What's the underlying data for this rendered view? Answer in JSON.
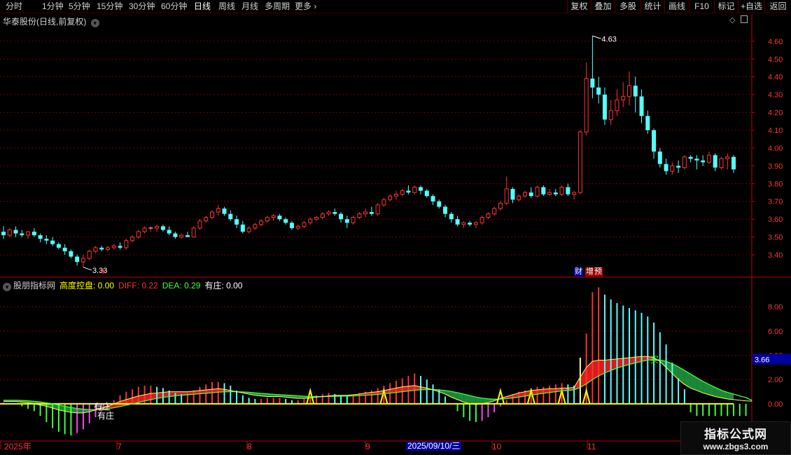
{
  "toolbar": {
    "periods": [
      "分时",
      "1分钟",
      "5分钟",
      "15分钟",
      "30分钟",
      "60分钟",
      "日线",
      "周线",
      "月线",
      "多周期",
      "更多"
    ],
    "active_period": "日线",
    "right_buttons": [
      "复权",
      "叠加",
      "多股",
      "统计",
      "画线",
      "F10",
      "标记",
      "+自选",
      "返回"
    ]
  },
  "stock": {
    "title": "华泰股份(日线,前复权)",
    "high_label": "4.63",
    "low_label": "3.33"
  },
  "price_axis": {
    "ticks": [
      "4.60",
      "4.50",
      "4.40",
      "4.30",
      "4.20",
      "4.10",
      "4.00",
      "3.90",
      "3.80",
      "3.70",
      "3.60",
      "3.50",
      "3.40"
    ]
  },
  "badges": {
    "cai": "财",
    "zeng": "增",
    "ji": "预",
    "mini": "♣"
  },
  "indicator": {
    "name": "股朋指标网",
    "items": [
      {
        "label": "高度控盘: 0.00",
        "color": "#ffff00"
      },
      {
        "label": "DIFF: 0.22",
        "color": "#ff3030"
      },
      {
        "label": "DEA: 0.29",
        "color": "#40ff40"
      },
      {
        "label": "有庄: 0.00",
        "color": "#ffffff"
      }
    ],
    "ticks": [
      "8.00",
      "6.00",
      "4.00",
      "2.00",
      "0.00"
    ],
    "current_value": "3.66",
    "annotations": {
      "you_zhuang": "有庄",
      "mai": "买"
    }
  },
  "dates": {
    "labels": [
      "2025年",
      "7",
      "8",
      "9",
      "10",
      "11"
    ],
    "cursor": "2025/09/10/三"
  },
  "watermark": {
    "main": "指标公式网",
    "sub": "www.zbgs3.com"
  },
  "colors": {
    "up": "#ff3232",
    "down": "#54ffff",
    "grid": "#7a0000",
    "axis": "#c00000"
  },
  "chart_data": {
    "type": "candlestick",
    "price_range": [
      3.29,
      4.69
    ],
    "candles": [
      [
        3.53,
        3.56,
        3.49,
        3.51
      ],
      [
        3.51,
        3.55,
        3.5,
        3.54
      ],
      [
        3.54,
        3.56,
        3.5,
        3.52
      ],
      [
        3.52,
        3.54,
        3.5,
        3.51
      ],
      [
        3.51,
        3.53,
        3.49,
        3.53
      ],
      [
        3.53,
        3.55,
        3.5,
        3.51
      ],
      [
        3.51,
        3.52,
        3.47,
        3.49
      ],
      [
        3.49,
        3.51,
        3.46,
        3.48
      ],
      [
        3.48,
        3.5,
        3.45,
        3.46
      ],
      [
        3.46,
        3.47,
        3.43,
        3.44
      ],
      [
        3.44,
        3.46,
        3.4,
        3.42
      ],
      [
        3.42,
        3.43,
        3.38,
        3.39
      ],
      [
        3.39,
        3.4,
        3.34,
        3.36
      ],
      [
        3.36,
        3.4,
        3.33,
        3.38
      ],
      [
        3.38,
        3.43,
        3.37,
        3.42
      ],
      [
        3.42,
        3.45,
        3.41,
        3.44
      ],
      [
        3.44,
        3.45,
        3.42,
        3.43
      ],
      [
        3.43,
        3.45,
        3.42,
        3.44
      ],
      [
        3.44,
        3.46,
        3.43,
        3.45
      ],
      [
        3.45,
        3.47,
        3.43,
        3.44
      ],
      [
        3.44,
        3.49,
        3.43,
        3.48
      ],
      [
        3.48,
        3.51,
        3.47,
        3.5
      ],
      [
        3.5,
        3.54,
        3.49,
        3.53
      ],
      [
        3.53,
        3.56,
        3.52,
        3.55
      ],
      [
        3.55,
        3.56,
        3.53,
        3.55
      ],
      [
        3.55,
        3.57,
        3.53,
        3.56
      ],
      [
        3.56,
        3.57,
        3.53,
        3.54
      ],
      [
        3.54,
        3.56,
        3.51,
        3.52
      ],
      [
        3.52,
        3.53,
        3.49,
        3.5
      ],
      [
        3.5,
        3.52,
        3.49,
        3.51
      ],
      [
        3.51,
        3.53,
        3.5,
        3.5
      ],
      [
        3.5,
        3.56,
        3.5,
        3.55
      ],
      [
        3.55,
        3.6,
        3.54,
        3.59
      ],
      [
        3.59,
        3.62,
        3.58,
        3.61
      ],
      [
        3.61,
        3.65,
        3.6,
        3.64
      ],
      [
        3.64,
        3.68,
        3.62,
        3.66
      ],
      [
        3.66,
        3.67,
        3.62,
        3.63
      ],
      [
        3.63,
        3.65,
        3.59,
        3.6
      ],
      [
        3.6,
        3.62,
        3.55,
        3.57
      ],
      [
        3.57,
        3.59,
        3.52,
        3.53
      ],
      [
        3.53,
        3.56,
        3.52,
        3.55
      ],
      [
        3.55,
        3.58,
        3.54,
        3.57
      ],
      [
        3.57,
        3.6,
        3.56,
        3.59
      ],
      [
        3.59,
        3.62,
        3.58,
        3.61
      ],
      [
        3.61,
        3.63,
        3.59,
        3.62
      ],
      [
        3.62,
        3.63,
        3.59,
        3.6
      ],
      [
        3.6,
        3.61,
        3.57,
        3.58
      ],
      [
        3.58,
        3.59,
        3.54,
        3.55
      ],
      [
        3.55,
        3.57,
        3.54,
        3.56
      ],
      [
        3.56,
        3.59,
        3.55,
        3.58
      ],
      [
        3.58,
        3.61,
        3.57,
        3.6
      ],
      [
        3.6,
        3.62,
        3.59,
        3.61
      ],
      [
        3.61,
        3.64,
        3.6,
        3.63
      ],
      [
        3.63,
        3.65,
        3.62,
        3.64
      ],
      [
        3.64,
        3.66,
        3.62,
        3.63
      ],
      [
        3.63,
        3.64,
        3.58,
        3.6
      ],
      [
        3.6,
        3.62,
        3.55,
        3.58
      ],
      [
        3.58,
        3.62,
        3.57,
        3.61
      ],
      [
        3.61,
        3.64,
        3.6,
        3.63
      ],
      [
        3.63,
        3.66,
        3.61,
        3.64
      ],
      [
        3.64,
        3.67,
        3.62,
        3.63
      ],
      [
        3.63,
        3.69,
        3.62,
        3.68
      ],
      [
        3.68,
        3.72,
        3.67,
        3.71
      ],
      [
        3.71,
        3.74,
        3.7,
        3.73
      ],
      [
        3.73,
        3.76,
        3.71,
        3.74
      ],
      [
        3.74,
        3.77,
        3.73,
        3.76
      ],
      [
        3.76,
        3.79,
        3.74,
        3.75
      ],
      [
        3.75,
        3.79,
        3.74,
        3.78
      ],
      [
        3.78,
        3.79,
        3.74,
        3.76
      ],
      [
        3.76,
        3.77,
        3.72,
        3.73
      ],
      [
        3.73,
        3.74,
        3.68,
        3.7
      ],
      [
        3.7,
        3.71,
        3.66,
        3.67
      ],
      [
        3.67,
        3.68,
        3.61,
        3.63
      ],
      [
        3.63,
        3.64,
        3.58,
        3.6
      ],
      [
        3.6,
        3.62,
        3.56,
        3.57
      ],
      [
        3.57,
        3.59,
        3.55,
        3.58
      ],
      [
        3.58,
        3.59,
        3.56,
        3.57
      ],
      [
        3.57,
        3.59,
        3.55,
        3.58
      ],
      [
        3.58,
        3.62,
        3.57,
        3.61
      ],
      [
        3.61,
        3.64,
        3.6,
        3.63
      ],
      [
        3.63,
        3.67,
        3.62,
        3.66
      ],
      [
        3.66,
        3.7,
        3.65,
        3.69
      ],
      [
        3.69,
        3.84,
        3.68,
        3.77
      ],
      [
        3.77,
        3.78,
        3.69,
        3.71
      ],
      [
        3.71,
        3.74,
        3.7,
        3.73
      ],
      [
        3.73,
        3.76,
        3.72,
        3.75
      ],
      [
        3.75,
        3.78,
        3.72,
        3.73
      ],
      [
        3.73,
        3.79,
        3.72,
        3.78
      ],
      [
        3.78,
        3.79,
        3.73,
        3.74
      ],
      [
        3.74,
        3.77,
        3.73,
        3.75
      ],
      [
        3.75,
        3.77,
        3.73,
        3.74
      ],
      [
        3.74,
        3.79,
        3.73,
        3.78
      ],
      [
        3.78,
        3.8,
        3.73,
        3.74
      ],
      [
        3.74,
        3.76,
        3.71,
        3.75
      ],
      [
        3.75,
        4.1,
        3.74,
        4.09
      ],
      [
        4.09,
        4.48,
        4.07,
        4.39
      ],
      [
        4.39,
        4.63,
        4.28,
        4.34
      ],
      [
        4.34,
        4.4,
        4.25,
        4.3
      ],
      [
        4.3,
        4.34,
        4.13,
        4.16
      ],
      [
        4.16,
        4.27,
        4.13,
        4.21
      ],
      [
        4.21,
        4.33,
        4.18,
        4.27
      ],
      [
        4.27,
        4.37,
        4.23,
        4.29
      ],
      [
        4.29,
        4.43,
        4.24,
        4.35
      ],
      [
        4.35,
        4.4,
        4.2,
        4.29
      ],
      [
        4.29,
        4.33,
        4.14,
        4.18
      ],
      [
        4.18,
        4.21,
        4.08,
        4.1
      ],
      [
        4.1,
        4.11,
        3.94,
        3.98
      ],
      [
        3.98,
        4.0,
        3.89,
        3.91
      ],
      [
        3.91,
        3.94,
        3.85,
        3.87
      ],
      [
        3.87,
        3.92,
        3.85,
        3.9
      ],
      [
        3.9,
        3.93,
        3.86,
        3.89
      ],
      [
        3.89,
        3.96,
        3.88,
        3.95
      ],
      [
        3.95,
        3.96,
        3.92,
        3.94
      ],
      [
        3.94,
        3.96,
        3.88,
        3.93
      ],
      [
        3.93,
        3.96,
        3.9,
        3.92
      ],
      [
        3.92,
        3.98,
        3.91,
        3.96
      ],
      [
        3.96,
        3.97,
        3.87,
        3.89
      ],
      [
        3.89,
        3.95,
        3.88,
        3.94
      ],
      [
        3.94,
        3.97,
        3.88,
        3.95
      ],
      [
        3.95,
        3.96,
        3.86,
        3.88
      ]
    ],
    "indicator_range": [
      -2.6,
      9.8
    ],
    "macd_bars": [
      0.1,
      0.05,
      0.0,
      -0.2,
      -0.4,
      -0.6,
      -1.0,
      -1.5,
      -2.0,
      -2.3,
      -2.5,
      -2.6,
      -2.4,
      -2.1,
      -1.6,
      -1.1,
      -0.6,
      -0.2,
      0.3,
      0.7,
      1.0,
      1.2,
      1.4,
      1.5,
      1.5,
      1.4,
      1.3,
      1.1,
      0.9,
      0.8,
      0.9,
      1.1,
      1.4,
      1.6,
      1.8,
      1.8,
      1.7,
      1.5,
      1.1,
      0.7,
      0.5,
      0.4,
      0.4,
      0.5,
      0.5,
      0.5,
      0.4,
      0.3,
      0.3,
      0.4,
      0.5,
      0.7,
      0.8,
      0.9,
      0.8,
      0.7,
      0.6,
      0.7,
      0.9,
      1.0,
      1.1,
      1.3,
      1.5,
      1.7,
      1.9,
      2.1,
      2.3,
      2.5,
      2.3,
      2.0,
      1.6,
      1.2,
      0.6,
      0.0,
      -0.6,
      -1.1,
      -1.4,
      -1.5,
      -1.4,
      -1.1,
      -0.7,
      -0.2,
      0.3,
      0.8,
      1.0,
      1.1,
      1.3,
      1.4,
      1.4,
      1.5,
      1.6,
      1.7,
      1.6,
      1.5,
      3.8,
      5.8,
      9.2,
      9.6,
      9.0,
      8.6,
      8.3,
      8.1,
      7.9,
      7.7,
      7.5,
      7.2,
      6.7,
      5.9,
      4.9,
      3.4,
      2.1,
      1.2,
      -0.7,
      -1.0,
      -1.0,
      -1.0,
      -1.0,
      -1.0,
      -1.0,
      -1.0,
      -1.0,
      -1.0
    ],
    "diff": [
      0.2,
      0.2,
      0.2,
      0.15,
      0.1,
      0.0,
      -0.1,
      -0.2,
      -0.35,
      -0.5,
      -0.6,
      -0.7,
      -0.75,
      -0.75,
      -0.65,
      -0.5,
      -0.35,
      -0.2,
      0.0,
      0.2,
      0.35,
      0.5,
      0.65,
      0.75,
      0.85,
      0.9,
      0.95,
      1.0,
      1.0,
      1.0,
      1.0,
      1.05,
      1.1,
      1.15,
      1.2,
      1.25,
      1.2,
      1.1,
      1.0,
      0.9,
      0.8,
      0.7,
      0.65,
      0.6,
      0.6,
      0.6,
      0.55,
      0.5,
      0.45,
      0.45,
      0.5,
      0.55,
      0.6,
      0.65,
      0.7,
      0.7,
      0.7,
      0.75,
      0.8,
      0.9,
      0.95,
      1.0,
      1.1,
      1.2,
      1.3,
      1.4,
      1.45,
      1.5,
      1.4,
      1.3,
      1.15,
      1.0,
      0.8,
      0.55,
      0.35,
      0.15,
      0.0,
      -0.05,
      0.0,
      0.1,
      0.25,
      0.45,
      0.6,
      0.75,
      0.9,
      1.0,
      1.1,
      1.15,
      1.2,
      1.25,
      1.25,
      1.3,
      1.3,
      1.35,
      2.2,
      3.0,
      3.5,
      3.6,
      3.6,
      3.65,
      3.7,
      3.75,
      3.8,
      3.85,
      3.9,
      3.9,
      3.8,
      3.5,
      3.0,
      2.5,
      2.0,
      1.6,
      1.3,
      1.1,
      0.9,
      0.75,
      0.6,
      0.5,
      0.4,
      0.35,
      0.3,
      0.25,
      0.22
    ],
    "dea": [
      0.3,
      0.3,
      0.3,
      0.28,
      0.25,
      0.2,
      0.15,
      0.08,
      0.0,
      -0.1,
      -0.2,
      -0.3,
      -0.38,
      -0.44,
      -0.48,
      -0.48,
      -0.45,
      -0.4,
      -0.32,
      -0.22,
      -0.12,
      0.0,
      0.12,
      0.24,
      0.35,
      0.45,
      0.53,
      0.6,
      0.66,
      0.71,
      0.75,
      0.79,
      0.83,
      0.87,
      0.91,
      0.96,
      0.99,
      1.0,
      1.0,
      0.98,
      0.95,
      0.9,
      0.86,
      0.82,
      0.78,
      0.75,
      0.72,
      0.69,
      0.66,
      0.63,
      0.61,
      0.6,
      0.6,
      0.61,
      0.62,
      0.63,
      0.64,
      0.66,
      0.68,
      0.71,
      0.74,
      0.78,
      0.83,
      0.88,
      0.94,
      1.0,
      1.06,
      1.12,
      1.16,
      1.18,
      1.18,
      1.15,
      1.1,
      1.02,
      0.92,
      0.8,
      0.68,
      0.56,
      0.47,
      0.41,
      0.38,
      0.39,
      0.43,
      0.49,
      0.56,
      0.64,
      0.72,
      0.8,
      0.87,
      0.94,
      1.0,
      1.06,
      1.11,
      1.16,
      1.35,
      1.65,
      2.0,
      2.3,
      2.55,
      2.75,
      2.95,
      3.1,
      3.25,
      3.38,
      3.5,
      3.6,
      3.65,
      3.62,
      3.5,
      3.3,
      3.05,
      2.75,
      2.45,
      2.15,
      1.85,
      1.6,
      1.35,
      1.12,
      0.95,
      0.8,
      0.65,
      0.52,
      0.29
    ]
  }
}
